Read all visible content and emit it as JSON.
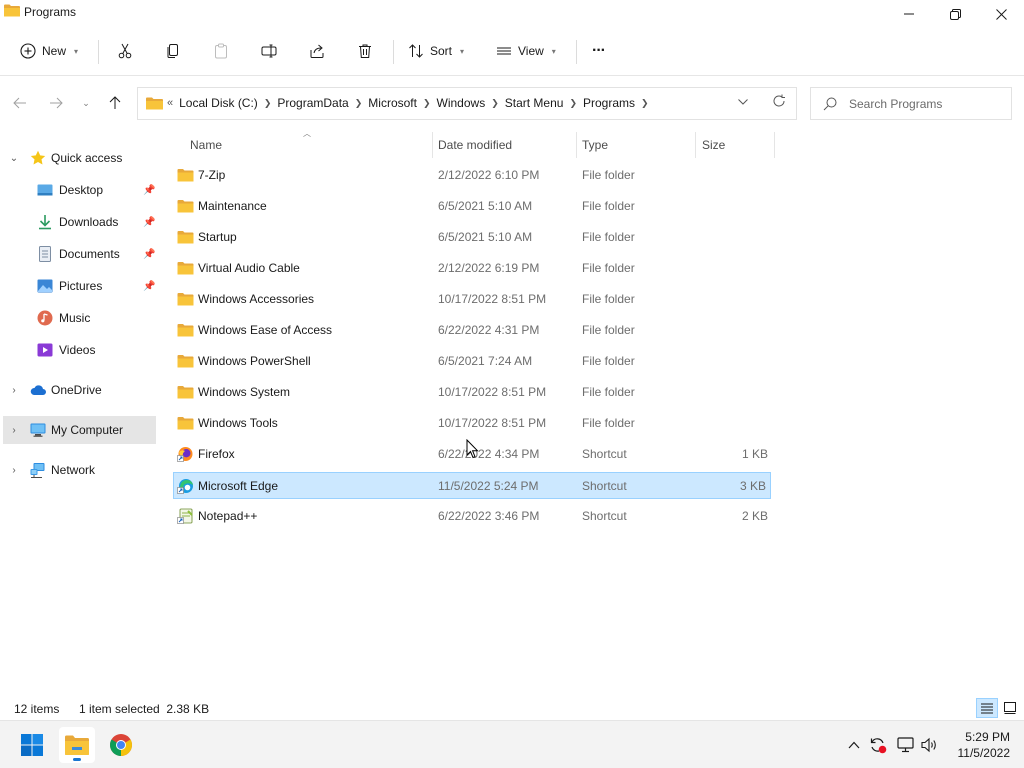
{
  "window": {
    "title": "Programs"
  },
  "toolbar": {
    "new_label": "New",
    "sort_label": "Sort",
    "view_label": "View",
    "more_label": "···"
  },
  "address": {
    "overflow": "«",
    "crumbs": [
      "Local Disk (C:)",
      "ProgramData",
      "Microsoft",
      "Windows",
      "Start Menu",
      "Programs"
    ]
  },
  "search": {
    "placeholder": "Search Programs",
    "value": ""
  },
  "nav": {
    "quick_access": "Quick access",
    "desktop": "Desktop",
    "downloads": "Downloads",
    "documents": "Documents",
    "pictures": "Pictures",
    "music": "Music",
    "videos": "Videos",
    "onedrive": "OneDrive",
    "my_computer": "My Computer",
    "network": "Network"
  },
  "columns": {
    "name": "Name",
    "date": "Date modified",
    "type": "Type",
    "size": "Size"
  },
  "files": [
    {
      "name": "7-Zip",
      "date": "2/12/2022 6:10 PM",
      "type": "File folder",
      "size": "",
      "icon": "folder"
    },
    {
      "name": "Maintenance",
      "date": "6/5/2021 5:10 AM",
      "type": "File folder",
      "size": "",
      "icon": "folder"
    },
    {
      "name": "Startup",
      "date": "6/5/2021 5:10 AM",
      "type": "File folder",
      "size": "",
      "icon": "folder"
    },
    {
      "name": "Virtual Audio Cable",
      "date": "2/12/2022 6:19 PM",
      "type": "File folder",
      "size": "",
      "icon": "folder"
    },
    {
      "name": "Windows Accessories",
      "date": "10/17/2022 8:51 PM",
      "type": "File folder",
      "size": "",
      "icon": "folder"
    },
    {
      "name": "Windows Ease of Access",
      "date": "6/22/2022 4:31 PM",
      "type": "File folder",
      "size": "",
      "icon": "folder"
    },
    {
      "name": "Windows PowerShell",
      "date": "6/5/2021 7:24 AM",
      "type": "File folder",
      "size": "",
      "icon": "folder"
    },
    {
      "name": "Windows System",
      "date": "10/17/2022 8:51 PM",
      "type": "File folder",
      "size": "",
      "icon": "folder"
    },
    {
      "name": "Windows Tools",
      "date": "10/17/2022 8:51 PM",
      "type": "File folder",
      "size": "",
      "icon": "folder"
    },
    {
      "name": "Firefox",
      "date": "6/22/2022 4:34 PM",
      "type": "Shortcut",
      "size": "1 KB",
      "icon": "firefox"
    },
    {
      "name": "Microsoft Edge",
      "date": "11/5/2022 5:24 PM",
      "type": "Shortcut",
      "size": "3 KB",
      "icon": "edge"
    },
    {
      "name": "Notepad++",
      "date": "6/22/2022 3:46 PM",
      "type": "Shortcut",
      "size": "2 KB",
      "icon": "notepadpp"
    }
  ],
  "status": {
    "count": "12 items",
    "selection": "1 item selected  2.38 KB"
  },
  "clock": {
    "time": "5:29 PM",
    "date": "11/5/2022"
  },
  "colors": {
    "selection_bg": "#cce8ff",
    "selection_border": "#99d1ff",
    "folder_yellow": "#f8c43a",
    "accent": "#0067c0"
  }
}
